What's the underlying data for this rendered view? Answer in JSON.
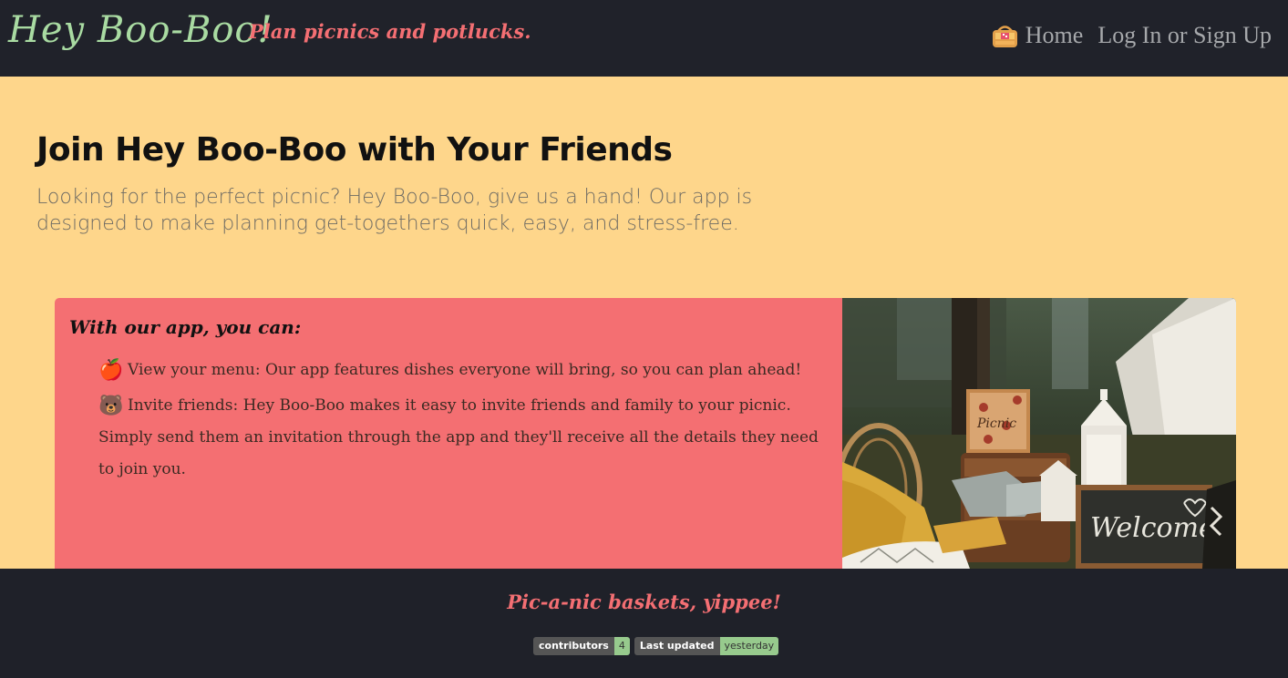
{
  "nav": {
    "brand": "Hey Boo-Boo!",
    "tagline": "Plan picnics and potlucks.",
    "links": [
      {
        "label": "Home"
      },
      {
        "label": "Log In or Sign Up"
      }
    ],
    "icon": "picnic-basket-icon"
  },
  "hero": {
    "title": "Join Hey Boo-Boo with Your Friends",
    "lead": "Looking for the perfect picnic? Hey Boo-Boo, give us a hand! Our app is designed to make planning get-togethers quick, easy, and stress-free."
  },
  "features": {
    "heading": "With our app, you can:",
    "items": [
      {
        "icon": "apple-icon",
        "glyph": "🍎",
        "text": "View your menu: Our app features dishes everyone will bring, so you can plan ahead!"
      },
      {
        "icon": "bear-icon",
        "glyph": "🐻",
        "text": "Invite friends: Hey Boo-Boo makes it easy to invite friends and family to your picnic. Simply send them an invitation through the app and they'll receive all the details they need to join you."
      }
    ],
    "image_sign": "Welcome",
    "image_box_text": "Picnic"
  },
  "footer": {
    "text": "Pic-a-nic baskets, yippee!",
    "badges": [
      {
        "key": "contributors",
        "value": "4"
      },
      {
        "key": "Last updated",
        "value": "yesterday"
      }
    ]
  },
  "colors": {
    "navbar": "#20222a",
    "brand": "#a9dba2",
    "accent": "#f46f73",
    "hero_bg": "#fed68b",
    "card_bg": "#f46f72",
    "badge_value": "#97ca8d"
  }
}
